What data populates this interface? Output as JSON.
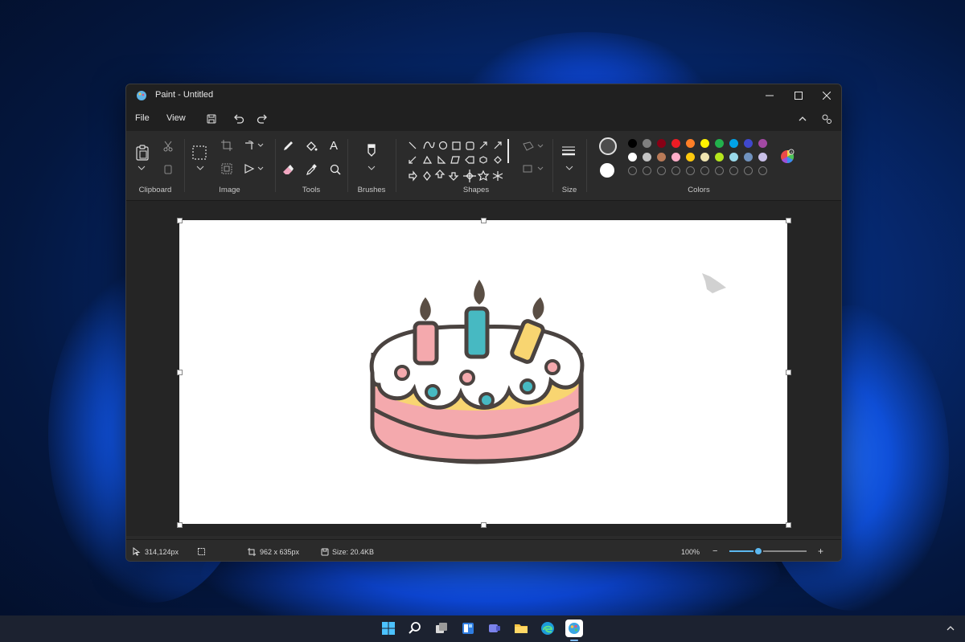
{
  "window": {
    "title": "Paint - Untitled"
  },
  "menu": {
    "file": "File",
    "view": "View"
  },
  "ribbon": {
    "groups": {
      "clipboard": "Clipboard",
      "image": "Image",
      "tools": "Tools",
      "brushes": "Brushes",
      "shapes": "Shapes",
      "size": "Size",
      "colors": "Colors"
    },
    "text_tool": "A"
  },
  "palette": {
    "row1": [
      "#000000",
      "#7f7f7f",
      "#880015",
      "#ed1c24",
      "#ff7f27",
      "#fff200",
      "#22b14c",
      "#00a2e8",
      "#3f48cc",
      "#a349a4"
    ],
    "row2": [
      "#ffffff",
      "#c3c3c3",
      "#b97a57",
      "#ffaec9",
      "#ffc90e",
      "#efe4b0",
      "#b5e61d",
      "#99d9ea",
      "#7092be",
      "#c8bfe7"
    ],
    "primary": "#4d4d4d",
    "secondary": "#ffffff"
  },
  "status": {
    "cursor_pos": "314,124px",
    "canvas_size": "962  x  635px",
    "file_size": "Size: 20.4KB",
    "zoom": "100%",
    "zoom_level": 0.37
  }
}
